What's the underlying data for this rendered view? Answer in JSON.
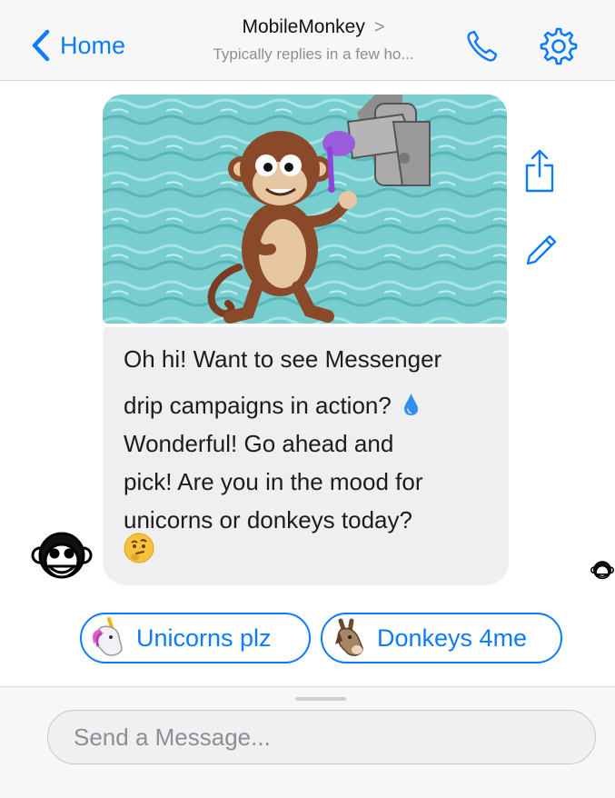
{
  "header": {
    "back_label": "Home",
    "title": "MobileMonkey",
    "title_chevron": ">",
    "subtitle": "Typically replies in a few ho..."
  },
  "message": {
    "line1": "Oh hi! Want to see Messenger",
    "line2": "drip campaigns in action?",
    "line3": "Wonderful! Go ahead and",
    "line4": "pick! Are you in the mood for",
    "line5": "unicorns or donkeys today?"
  },
  "quick_replies": [
    {
      "label": "Unicorns plz",
      "icon": "unicorn-emoji"
    },
    {
      "label": "Donkeys 4me",
      "icon": "donkey-emoji"
    }
  ],
  "composer": {
    "placeholder": "Send a Message..."
  },
  "colors": {
    "accent": "#0b7cff",
    "bubble": "#efeff2",
    "header_bg": "#f7f7f8"
  },
  "icons": [
    "chevron-left-icon",
    "phone-icon",
    "gear-icon",
    "share-icon",
    "edit-icon",
    "water-drop-icon",
    "thinking-face-icon",
    "monkey-avatar-icon"
  ]
}
